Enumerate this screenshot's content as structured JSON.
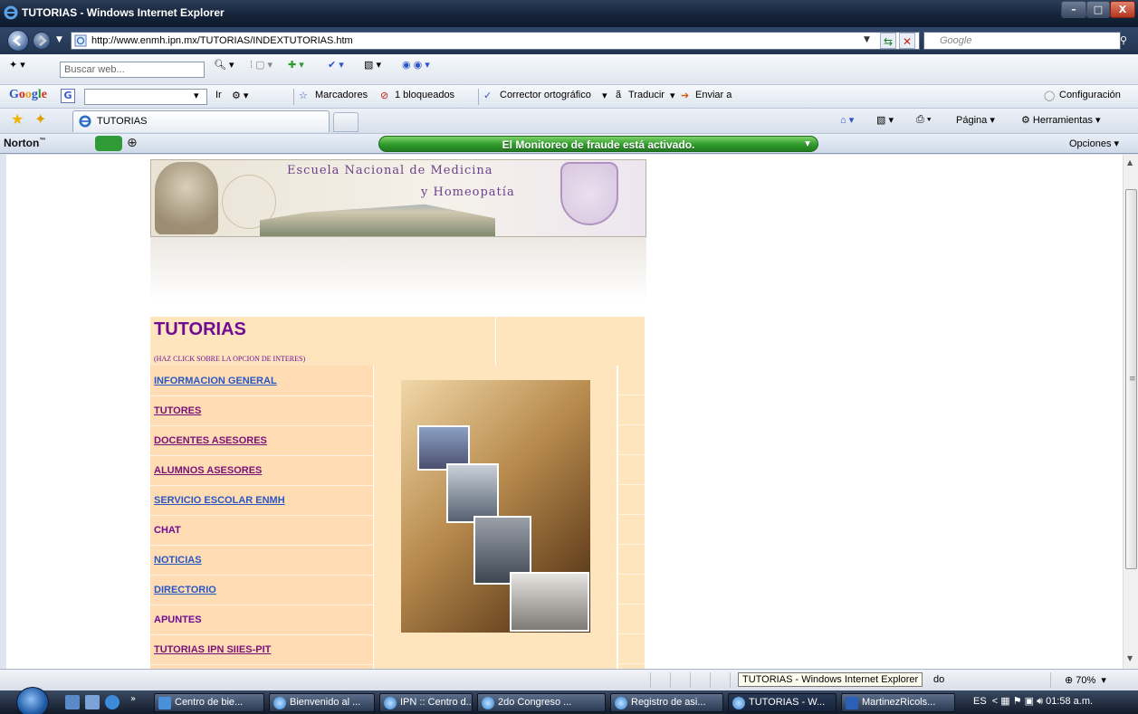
{
  "window": {
    "title": "TUTORIAS - Windows Internet Explorer",
    "min": "–",
    "max": "□",
    "close": "X"
  },
  "address": {
    "url": "http://www.enmh.ipn.mx/TUTORIAS/INDEXTUTORIAS.htm",
    "search_placeholder": "Google"
  },
  "toolbar1": {
    "search_placeholder": "Buscar web..."
  },
  "toolbar2": {
    "google_brand": "Google",
    "ir": "Ir",
    "marcadores": "Marcadores",
    "bloqueados": "1 bloqueados",
    "corrector": "Corrector ortográfico",
    "traducir": "Traducir",
    "enviar": "Enviar a",
    "configuracion": "Configuración"
  },
  "tabs": {
    "active_label": "TUTORIAS",
    "pagina": "Página",
    "herramientas": "Herramientas"
  },
  "norton": {
    "brand": "Norton",
    "fraud_message": "El Monitoreo de fraude está activado.",
    "opciones": "Opciones"
  },
  "banner": {
    "line1": "Escuela Nacional de Medicina",
    "line2": "y Homeopatía"
  },
  "page": {
    "title": "TUTORIAS",
    "subtitle": "(HAZ CLICK SOBRE LA OPCION DE INTERES)",
    "menu": [
      {
        "label": "INFORMACION GENERAL ",
        "style": "blue"
      },
      {
        "label": "TUTORES",
        "style": "purple"
      },
      {
        "label": "DOCENTES ASESORES ",
        "style": "purple"
      },
      {
        "label": "ALUMNOS ASESORES",
        "style": "purple"
      },
      {
        "label": "SERVICIO ESCOLAR ENMH",
        "style": "blue"
      },
      {
        "label": "CHAT",
        "style": "plain"
      },
      {
        "label": "NOTICIAS",
        "style": "blue"
      },
      {
        "label": "DIRECTORIO",
        "style": "blue"
      },
      {
        "label": "APUNTES",
        "style": "plain"
      },
      {
        "label": "TUTORIAS IPN SIIES-PIT ",
        "style": "purple"
      }
    ]
  },
  "status": {
    "tooltip": "TUTORIAS - Windows Internet Explorer",
    "text": "do",
    "zoom": "70%"
  },
  "taskbar": {
    "buttons": [
      "Centro de bie...",
      "Bienvenido al ...",
      "IPN :: Centro d...",
      "2do Congreso ...",
      "Registro de asi...",
      "TUTORIAS - W...",
      "MartinezRicols..."
    ],
    "lang": "ES",
    "clock": "01:58 a.m."
  },
  "colors": {
    "title_purple": "#6e0d94",
    "link_blue": "#2a57c2",
    "link_purple": "#7a1278",
    "menu_bg": "#ffdcb4",
    "norton_green": "#2f9a2c"
  }
}
